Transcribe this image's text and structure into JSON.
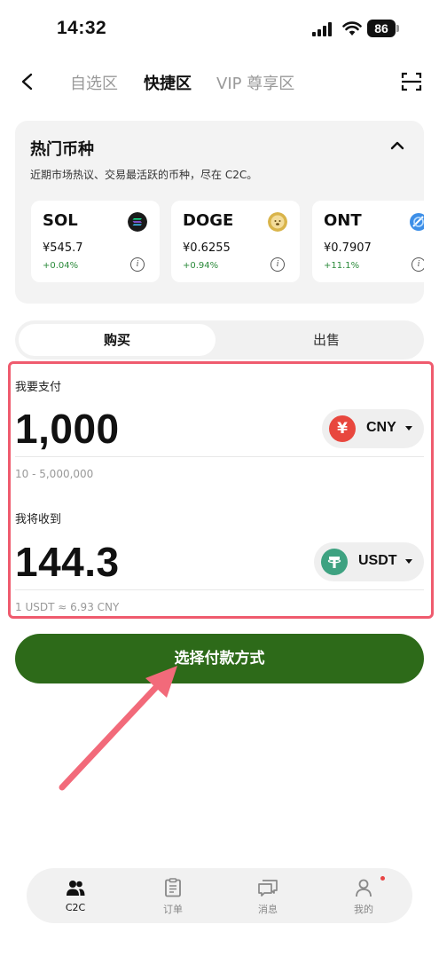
{
  "status": {
    "time": "14:32",
    "battery": "86"
  },
  "nav": {
    "tabs": [
      "自选区",
      "快捷区",
      "VIP 尊享区"
    ]
  },
  "hot": {
    "title": "热门币种",
    "subtitle": "近期市场热议、交易最活跃的币种，尽在 C2C。",
    "coins": [
      {
        "name": "SOL",
        "price": "¥545.7",
        "change": "+0.04%"
      },
      {
        "name": "DOGE",
        "price": "¥0.6255",
        "change": "+0.94%"
      },
      {
        "name": "ONT",
        "price": "¥0.7907",
        "change": "+11.1%"
      }
    ]
  },
  "trade": {
    "buy_label": "购买",
    "sell_label": "出售",
    "pay_label": "我要支付",
    "pay_value": "1,000",
    "pay_currency": "CNY",
    "pay_symbol": "¥",
    "pay_range": "10 - 5,000,000",
    "receive_label": "我将收到",
    "receive_value": "144.3",
    "receive_currency": "USDT",
    "rate": "1 USDT ≈ 6.93 CNY"
  },
  "cta": {
    "label": "选择付款方式"
  },
  "bottom_nav": [
    {
      "label": "C2C"
    },
    {
      "label": "订单"
    },
    {
      "label": "消息"
    },
    {
      "label": "我的"
    }
  ],
  "colors": {
    "accent": "#2d6a19",
    "highlight": "#ef5b6e",
    "positive": "#2a8a3a",
    "cny": "#e8473e",
    "usdt": "#3ea281"
  }
}
